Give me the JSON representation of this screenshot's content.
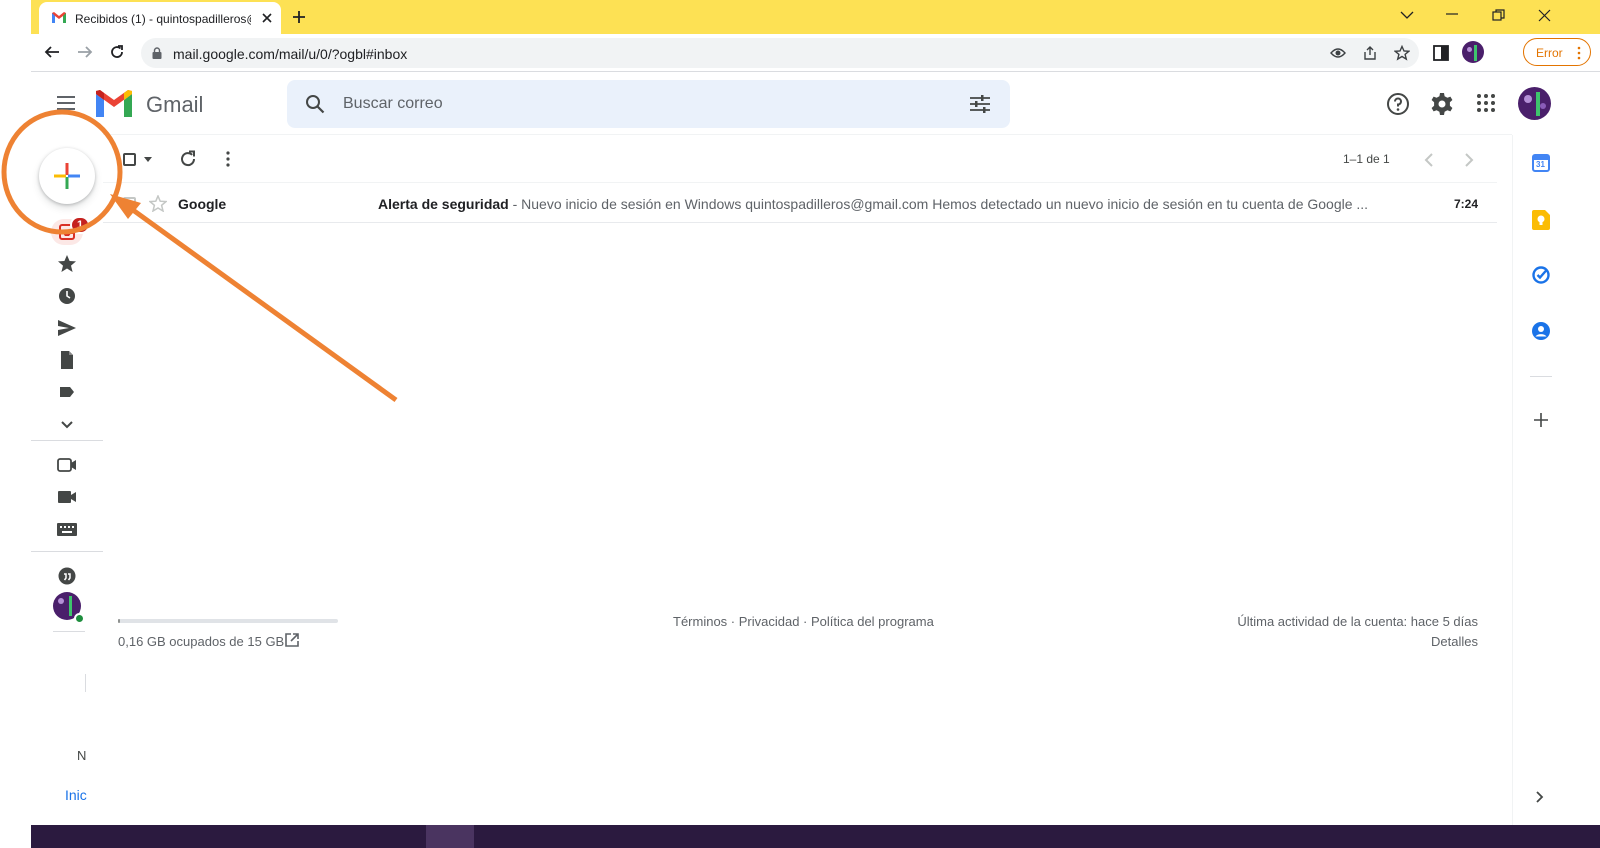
{
  "browser": {
    "tab_title": "Recibidos (1) - quintospadilleros@",
    "url": "mail.google.com/mail/u/0/?ogbl#inbox",
    "error_label": "Error"
  },
  "gmail": {
    "app_name": "Gmail",
    "search_placeholder": "Buscar correo",
    "inbox_badge": "1",
    "pagination": "1–1 de 1",
    "emails": [
      {
        "sender": "Google",
        "subject": "Alerta de seguridad",
        "snippet": " - Nuevo inicio de sesión en Windows quintospadilleros@gmail.com Hemos detectado un nuevo inicio de sesión en tu cuenta de Google ...",
        "time": "7:24"
      }
    ],
    "storage": "0,16 GB ocupados de 15 GB",
    "storage_fraction": 0.011,
    "footer_links": "Términos · Privacidad · Política del programa",
    "last_activity": "Última actividad de la cuenta: hace 5 días",
    "details": "Detalles",
    "leftover_n": "N",
    "leftover_inic": "Inic",
    "calendar_day": "31"
  },
  "colors": {
    "annotation": "#ee8233",
    "tabbar": "#fde154",
    "badge": "#c5221f"
  }
}
